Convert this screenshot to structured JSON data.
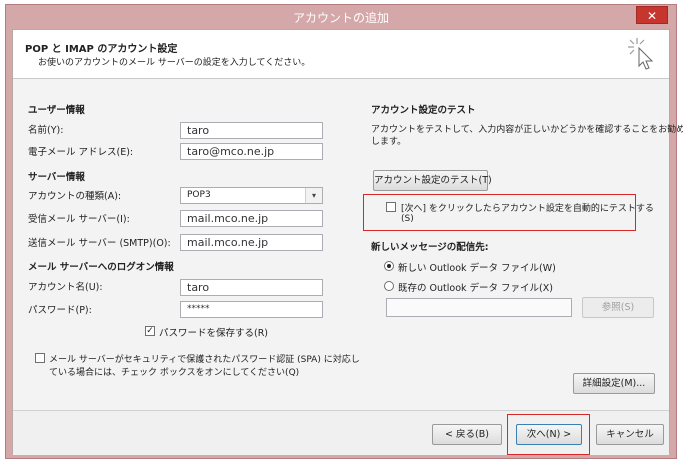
{
  "window": {
    "title": "アカウントの追加",
    "close": "✕"
  },
  "header": {
    "title": "POP と IMAP のアカウント設定",
    "subtitle": "お使いのアカウントのメール サーバーの設定を入力してください。"
  },
  "user_info": {
    "heading": "ユーザー情報",
    "name_label": "名前(Y):",
    "name_value": "taro",
    "email_label": "電子メール アドレス(E):",
    "email_value": "taro@mco.ne.jp"
  },
  "server_info": {
    "heading": "サーバー情報",
    "account_type_label": "アカウントの種類(A):",
    "account_type_value": "POP3",
    "incoming_label": "受信メール サーバー(I):",
    "incoming_value": "mail.mco.ne.jp",
    "outgoing_label": "送信メール サーバー (SMTP)(O):",
    "outgoing_value": "mail.mco.ne.jp"
  },
  "logon": {
    "heading": "メール サーバーへのログオン情報",
    "account_label": "アカウント名(U):",
    "account_value": "taro",
    "password_label": "パスワード(P):",
    "password_value": "*****",
    "remember_label": "パスワードを保存する(R)",
    "spa_label_line1": "メール サーバーがセキュリティで保護されたパスワード認証 (SPA) に対応し",
    "spa_label_line2": "ている場合には、チェック ボックスをオンにしてください(Q)"
  },
  "test": {
    "heading": "アカウント設定のテスト",
    "description_line1": "アカウントをテストして、入力内容が正しいかどうかを確認することをお勧め",
    "description_line2": "します。",
    "test_button": "アカウント設定のテスト(T)",
    "auto_test_line1": "[次へ] をクリックしたらアカウント設定を自動的にテストする",
    "auto_test_line2": "(S)"
  },
  "delivery": {
    "heading": "新しいメッセージの配信先:",
    "new_file": "新しい Outlook データ ファイル(W)",
    "existing_file": "既存の Outlook データ ファイル(X)",
    "browse_button": "参照(S)"
  },
  "more_settings_button": "詳細設定(M)...",
  "footer": {
    "back": "< 戻る(B)",
    "next": "次へ(N) >",
    "cancel": "キャンセル"
  },
  "colors": {
    "titlebar": "#d4a7a8",
    "close": "#c7362e",
    "highlight": "#d62828"
  }
}
